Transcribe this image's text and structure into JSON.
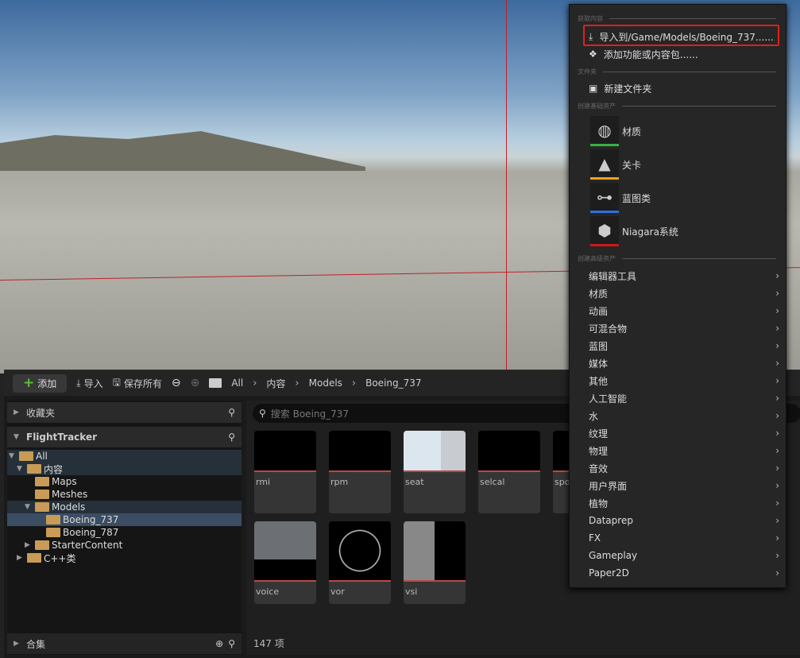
{
  "toolbar": {
    "add": "添加",
    "import": "导入",
    "save_all": "保存所有",
    "breadcrumb": [
      "All",
      "内容",
      "Models",
      "Boeing_737"
    ]
  },
  "left": {
    "favorites": "收藏夹",
    "project": "FlightTracker",
    "collections": "合集",
    "tree": [
      {
        "label": "All",
        "depth": 0
      },
      {
        "label": "内容",
        "depth": 1
      },
      {
        "label": "Maps",
        "depth": 2
      },
      {
        "label": "Meshes",
        "depth": 2
      },
      {
        "label": "Models",
        "depth": 2
      },
      {
        "label": "Boeing_737",
        "depth": 3
      },
      {
        "label": "Boeing_787",
        "depth": 3
      },
      {
        "label": "StarterContent",
        "depth": 2
      },
      {
        "label": "C++类",
        "depth": 1
      }
    ]
  },
  "search": {
    "placeholder": "搜索 Boeing_737"
  },
  "assets": [
    "rmi",
    "rpm",
    "seat",
    "selcal",
    "spo",
    "voice",
    "vor",
    "vsi"
  ],
  "item_count": "147 项",
  "menu": {
    "sec_get": "获取内容",
    "import": "导入到/Game/Models/Boeing_737......",
    "add_feature": "添加功能或内容包......",
    "sec_folder": "文件夹",
    "new_folder": "新建文件夹",
    "sec_basic": "创建基础资产",
    "basic": [
      {
        "label": "材质",
        "color": "#3cb043"
      },
      {
        "label": "关卡",
        "color": "#f0a020"
      },
      {
        "label": "蓝图类",
        "color": "#2f6fe0"
      },
      {
        "label": "Niagara系统",
        "color": "#d01818"
      }
    ],
    "sec_adv": "创建高级资产",
    "advanced": [
      "编辑器工具",
      "材质",
      "动画",
      "可混合物",
      "蓝图",
      "媒体",
      "其他",
      "人工智能",
      "水",
      "纹理",
      "物理",
      "音效",
      "用户界面",
      "植物",
      "Dataprep",
      "FX",
      "Gameplay",
      "Paper2D"
    ]
  }
}
